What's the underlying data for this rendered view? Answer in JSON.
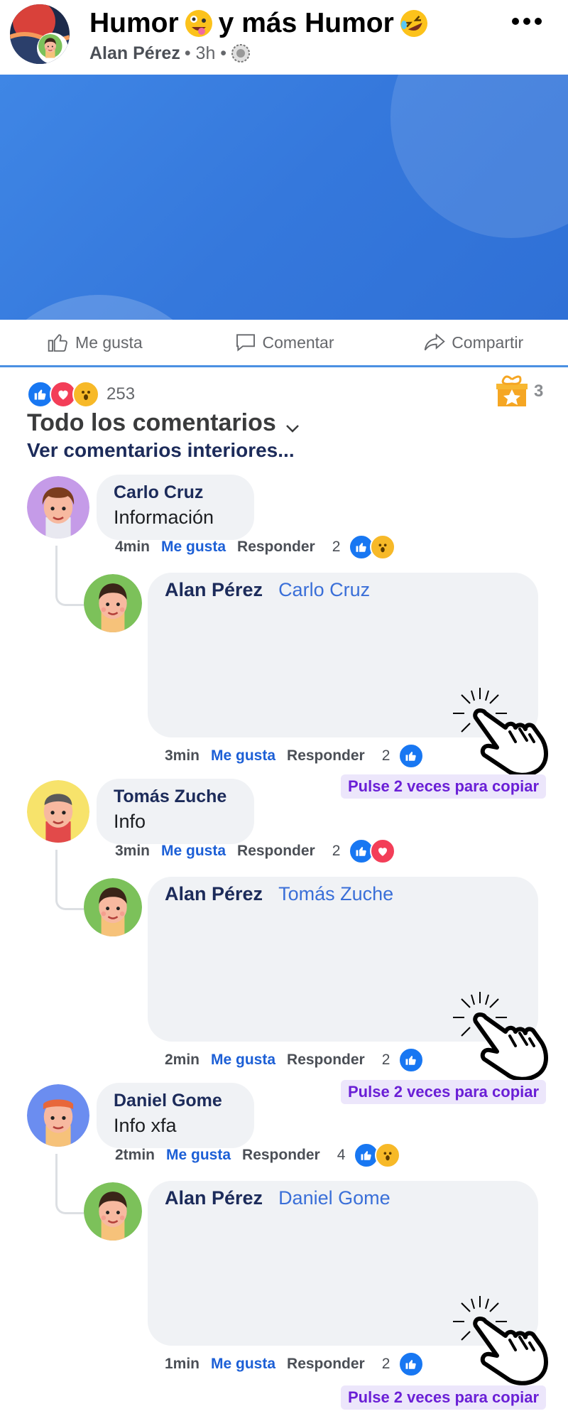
{
  "header": {
    "title_part1": "Humor",
    "title_part2": "y más Humor",
    "author": "Alan Pérez",
    "time": "• 3h •",
    "emoji1": "crazy-face-icon",
    "emoji2": "rofl-face-icon"
  },
  "actions": {
    "like": "Me gusta",
    "comment": "Comentar",
    "share": "Compartir"
  },
  "summary": {
    "reaction_count": "253",
    "gift_count": "3",
    "section_title": "Todo los comentarios",
    "view_more": "Ver comentarios interiores..."
  },
  "colors": {
    "like_blue": "#1877f2",
    "love_red": "#f33e58",
    "wow_yellow": "#f7b928",
    "banner_blue": "#3578dc",
    "hint_purple": "#6a1fd6"
  },
  "comments": [
    {
      "name": "Carlo Cruz",
      "text": "Información",
      "time": "4min",
      "like": "Me gusta",
      "reply_label": "Responder",
      "count": "2",
      "reply": {
        "name": "Alan Pérez",
        "mention": "Carlo Cruz",
        "time": "3min",
        "like": "Me gusta",
        "reply_label": "Responder",
        "count": "2",
        "hint": "Pulse 2 veces para copiar"
      }
    },
    {
      "name": "Tomás Zuche",
      "text": "Info",
      "time": "3min",
      "like": "Me gusta",
      "reply_label": "Responder",
      "count": "2",
      "reply": {
        "name": "Alan Pérez",
        "mention": "Tomás Zuche",
        "time": "2min",
        "like": "Me gusta",
        "reply_label": "Responder",
        "count": "2",
        "hint": "Pulse 2 veces para copiar"
      }
    },
    {
      "name": "Daniel Gome",
      "text": "Info xfa",
      "time": "2tmin",
      "like": "Me gusta",
      "reply_label": "Responder",
      "count": "4",
      "reply": {
        "name": "Alan Pérez",
        "mention": "Daniel Gome",
        "time": "1min",
        "like": "Me gusta",
        "reply_label": "Responder",
        "count": "2",
        "hint": "Pulse 2 veces para copiar"
      }
    }
  ]
}
